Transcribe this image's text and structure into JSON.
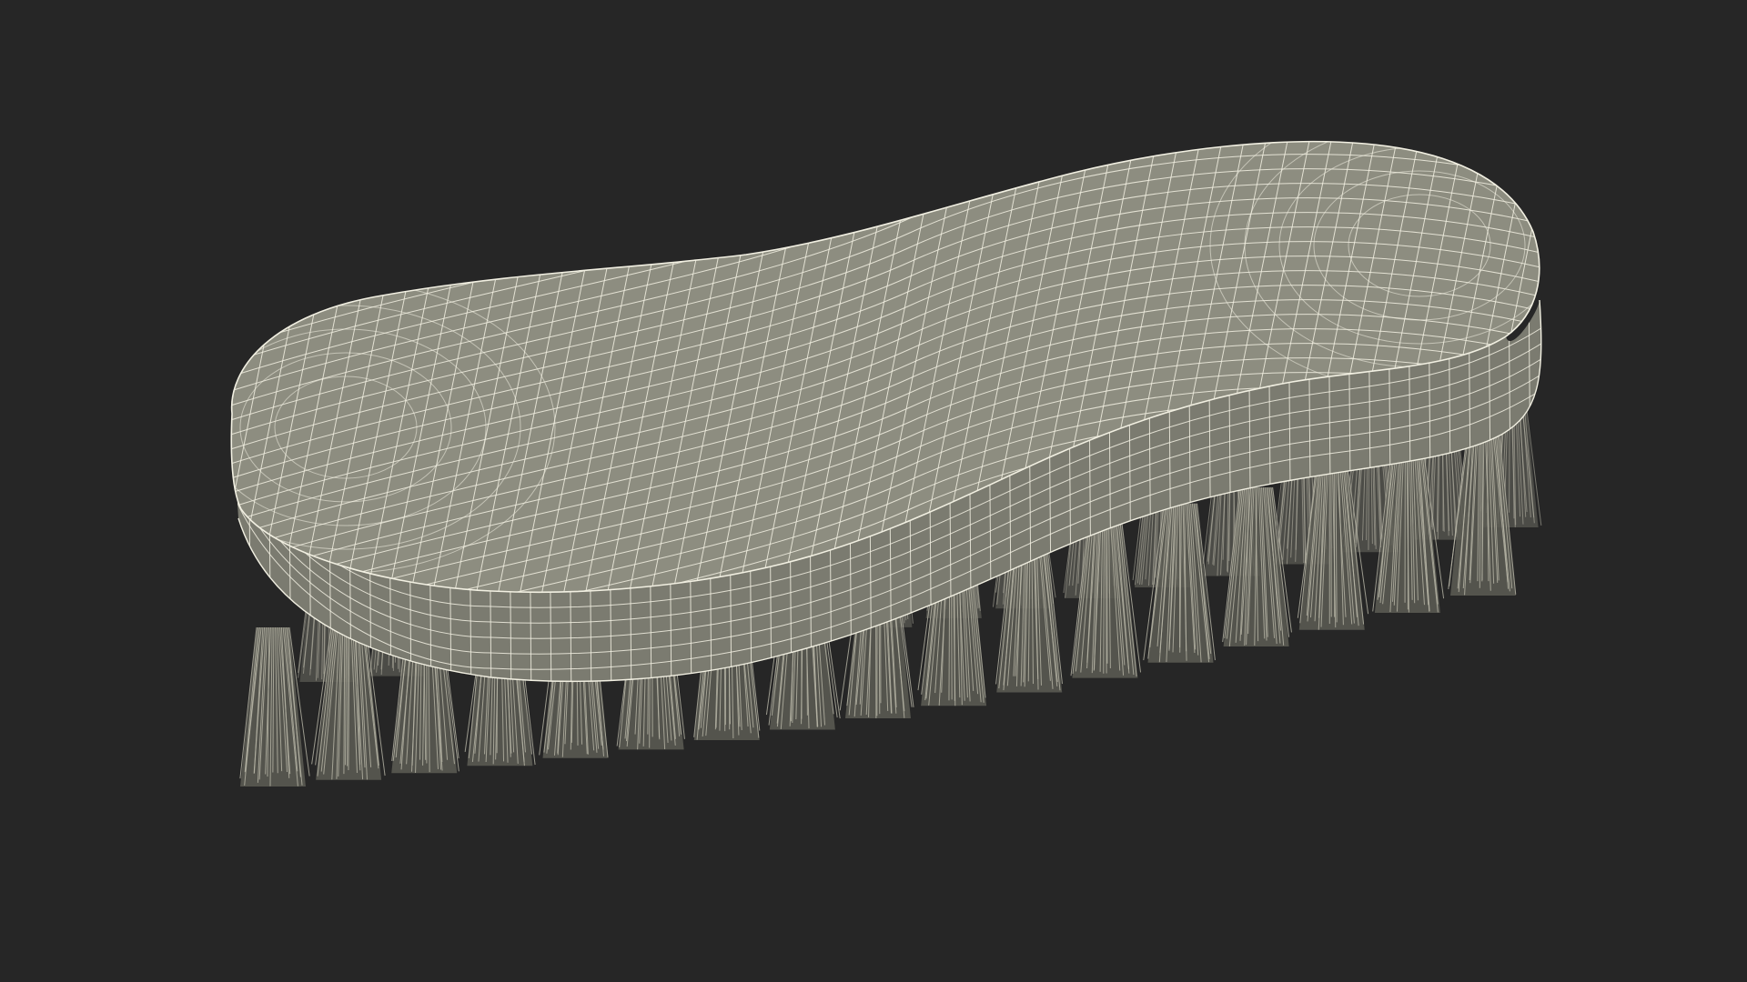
{
  "scene": {
    "subject": "scrub-brush-wireframe-render",
    "background_color": "#262626",
    "body_fill_color": "#8d8d80",
    "body_side_color": "#7b7b70",
    "wire_color": "#f2f0e2",
    "bristle_color": "#b9b7a8",
    "bristle_shadow_color": "#5d5d55"
  }
}
